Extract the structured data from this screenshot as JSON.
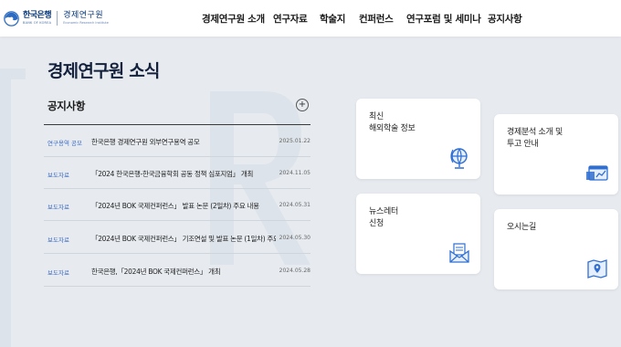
{
  "header": {
    "logo": {
      "bank_name": "한국은행",
      "bank_en": "BANK OF KOREA",
      "institute_name": "경제연구원",
      "institute_en": "Economic Research Institute"
    },
    "nav": [
      {
        "label": "경제연구원 소개"
      },
      {
        "label": "연구자료"
      },
      {
        "label": "학술지"
      },
      {
        "label": "컨퍼런스"
      },
      {
        "label": "연구포럼 및 세미나"
      },
      {
        "label": "공지사항"
      }
    ]
  },
  "main": {
    "title": "경제연구원 소식",
    "notices": {
      "heading": "공지사항",
      "more_label": "+",
      "items": [
        {
          "category": "연구용역 공모",
          "title": "한국은행 경제연구원 외부연구용역 공모",
          "date": "2025.01.22"
        },
        {
          "category": "보도자료",
          "title": "「2024 한국은행-한국금융학회 공동 정책 심포지엄」 개최",
          "date": "2024.11.05"
        },
        {
          "category": "보도자료",
          "title": "「2024년 BOK 국제컨퍼런스」 발표 논문 (2일차) 주요 내용",
          "date": "2024.05.31"
        },
        {
          "category": "보도자료",
          "title": "「2024년 BOK 국제컨퍼런스」 기조연설 및 발표 논문 (1일차) 주요 ···",
          "date": "2024.05.30"
        },
        {
          "category": "보도자료",
          "title": "한국은행,「2024년 BOK 국제컨퍼런스」 개최",
          "date": "2024.05.28"
        }
      ]
    },
    "cards": [
      {
        "label": "최신\n해외학술 정보",
        "icon": "globe-icon"
      },
      {
        "label": "경제분석 소개 및\n투고 안내",
        "icon": "chart-window-icon"
      },
      {
        "label": "뉴스레터\n신청",
        "icon": "mail-icon"
      },
      {
        "label": "오시는길",
        "icon": "map-icon"
      }
    ]
  },
  "colors": {
    "background": "#e7ebf0",
    "brand_navy": "#0d3a78",
    "category_blue": "#3c6bc4",
    "icon_blue": "#2f6fd1"
  }
}
